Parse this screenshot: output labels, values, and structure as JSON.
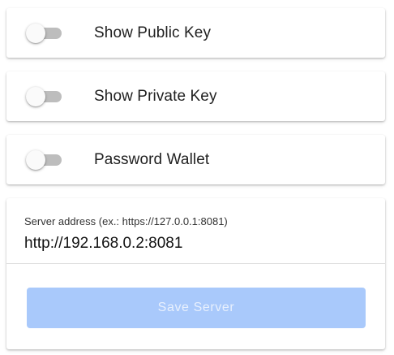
{
  "settings": {
    "toggles": [
      {
        "label": "Show Public Key",
        "checked": false
      },
      {
        "label": "Show Private Key",
        "checked": false
      },
      {
        "label": "Password Wallet",
        "checked": false
      }
    ]
  },
  "server": {
    "field_label": "Server address (ex.: https://127.0.0.1:8081)",
    "value": "http://192.168.0.2:8081",
    "save_label": "Save Server"
  },
  "colors": {
    "switch_track_off": "#bdbdbd",
    "switch_thumb_off": "#fafafa",
    "save_button_disabled_bg": "#a9c9fb",
    "save_button_disabled_text": "#e8f0fd"
  }
}
